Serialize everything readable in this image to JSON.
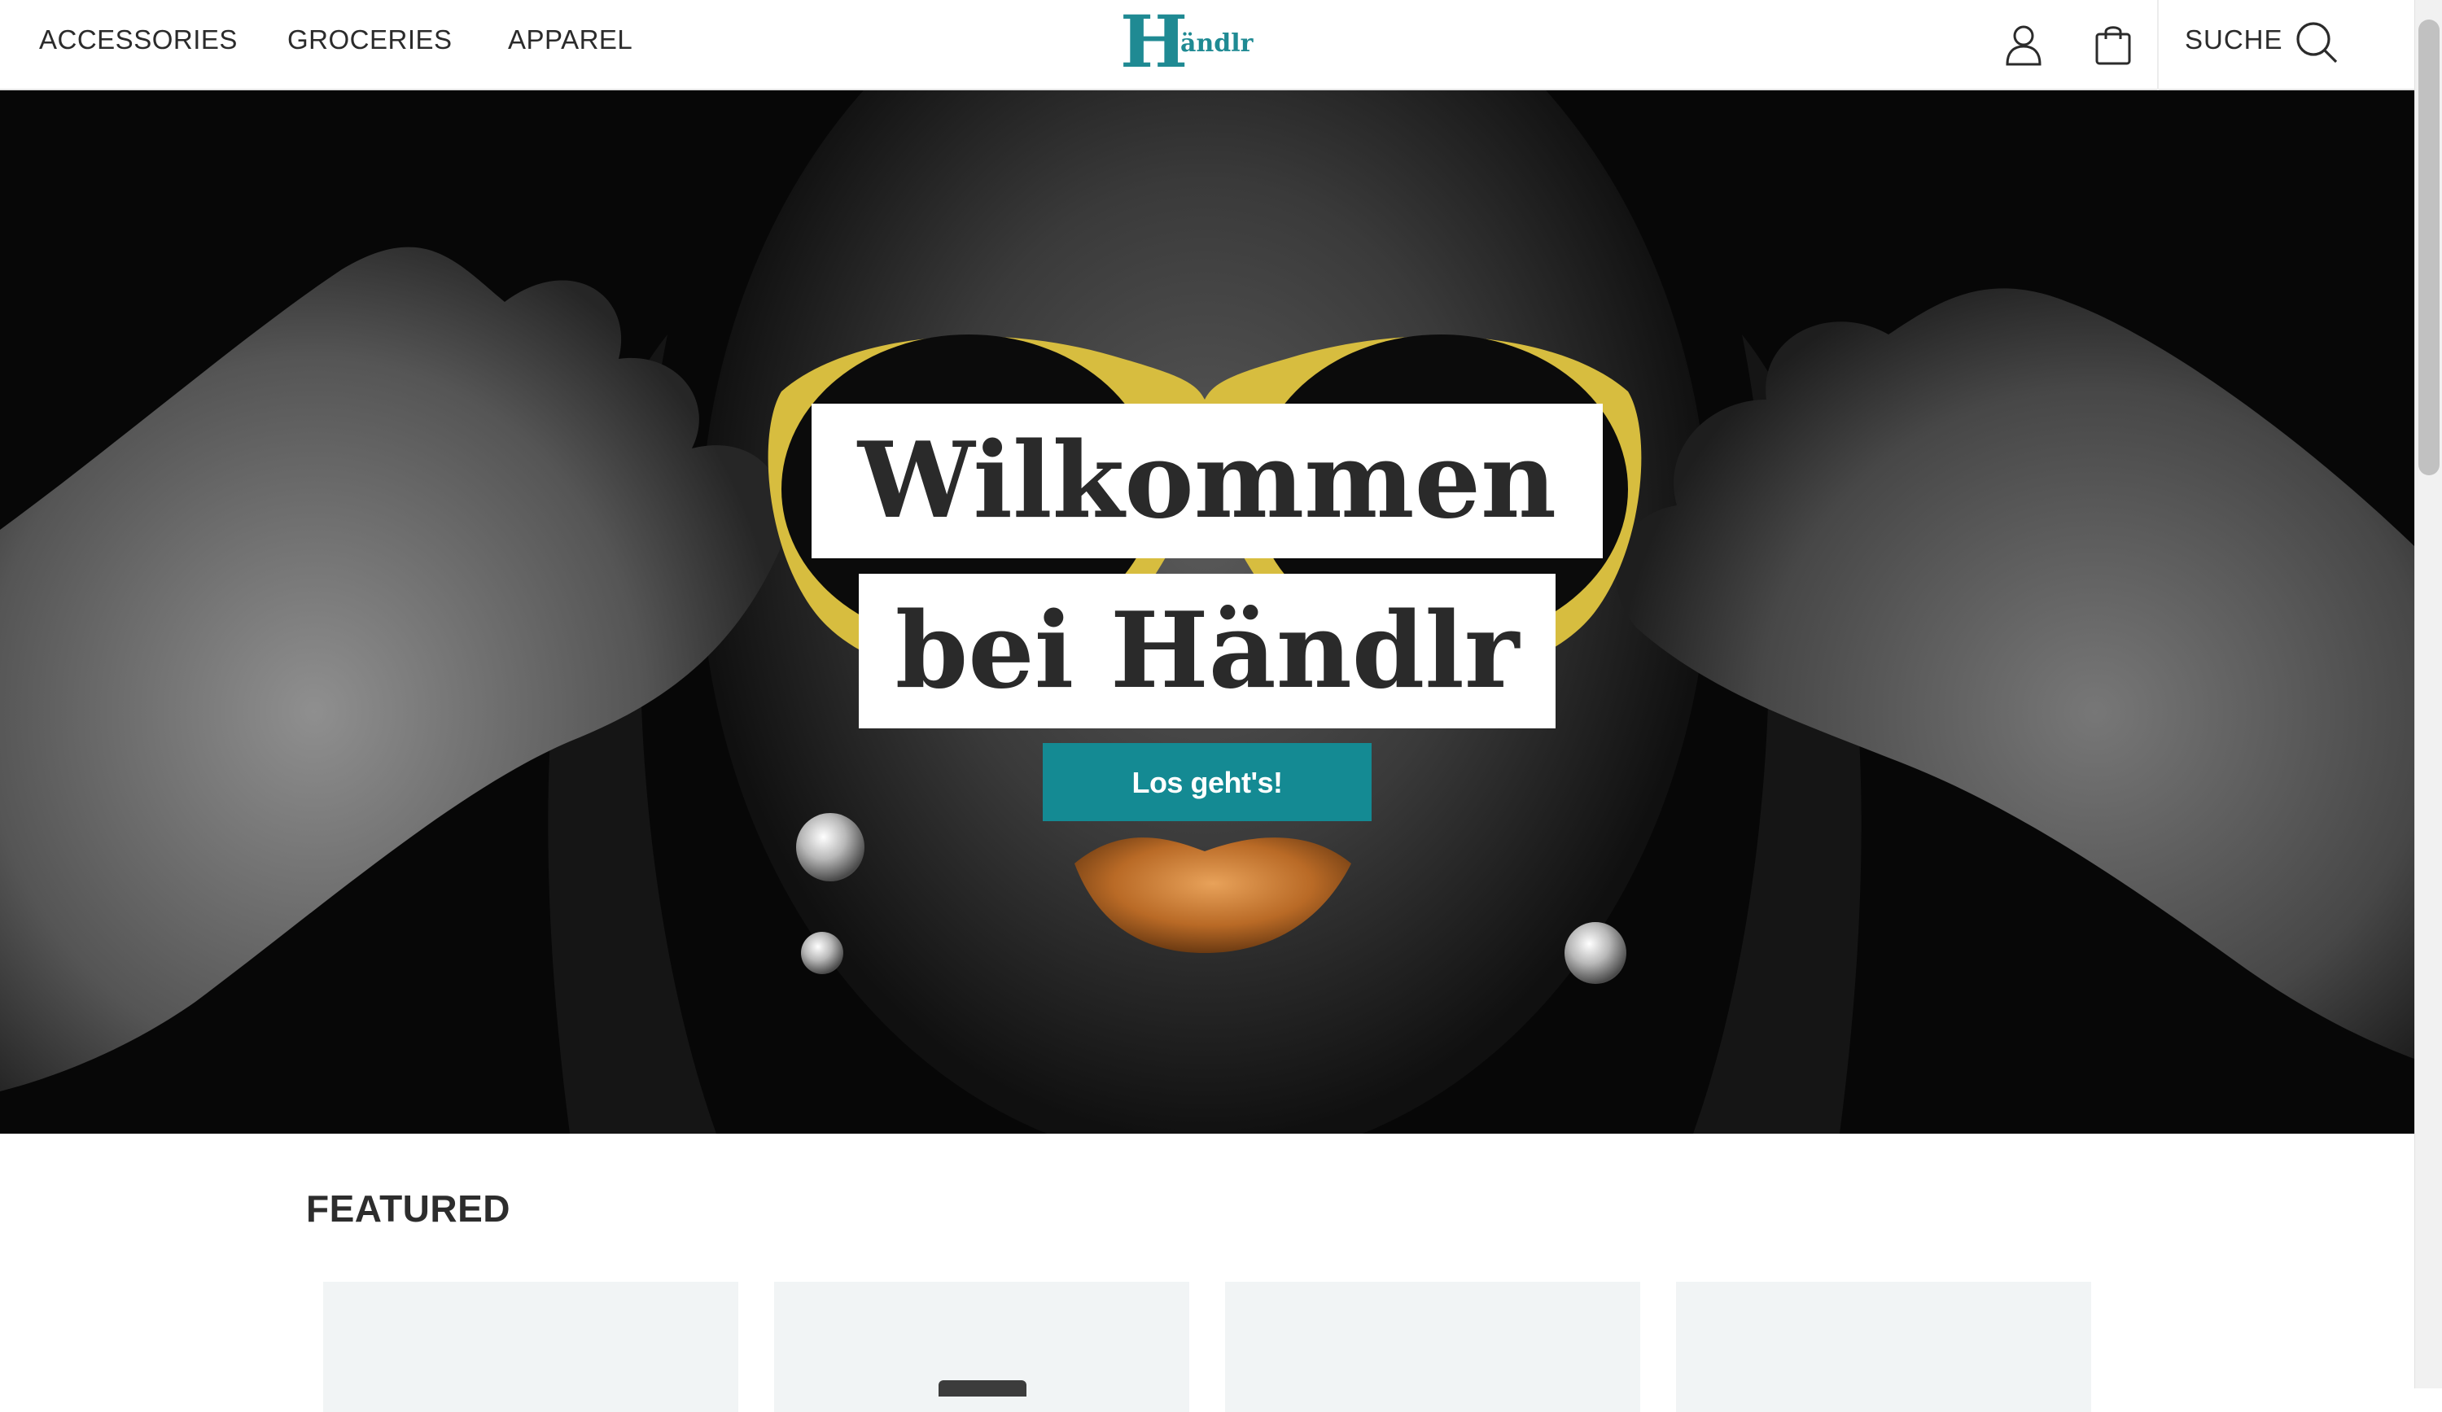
{
  "nav": {
    "links": [
      "ACCESSORIES",
      "GROCERIES",
      "APPAREL"
    ],
    "search_label": "SUCHE"
  },
  "brand": {
    "logo_initial": "H",
    "logo_rest": "ändlr",
    "color": "#1f8a93"
  },
  "icons": {
    "account": "user-icon",
    "cart": "shopping-bag-icon",
    "search": "search-icon"
  },
  "hero": {
    "headline_line1": "Wilkommen",
    "headline_line2": "bei Händlr",
    "cta_label": "Los geht's!",
    "cta_color": "#148a93",
    "image": "black-and-white portrait with yellow sunglasses and gold lips"
  },
  "featured": {
    "title": "FEATURED",
    "card_count": 4
  }
}
